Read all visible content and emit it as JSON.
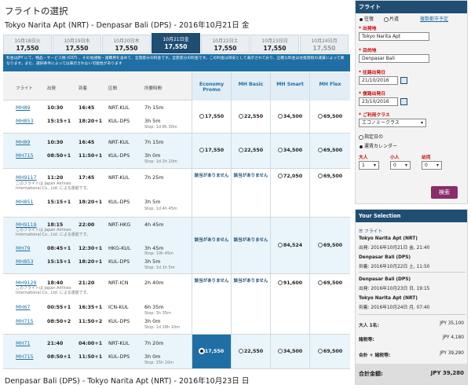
{
  "page": {
    "title": "フライトの選択",
    "outbound_route": "Tokyo Narita Apt (NRT) - Denpasar Bali (DPS) - 2016年10月21日 金",
    "return_route": "Denpasar Bali (DPS) - Tokyo Narita Apt (NRT) - 2016年10月23日 日"
  },
  "dates": [
    {
      "label": "10月18日火",
      "price": "17,550"
    },
    {
      "label": "10月19日水",
      "price": "17,550"
    },
    {
      "label": "10月20日木",
      "price": "17,550"
    },
    {
      "label": "10月21日金",
      "price": "17,550"
    },
    {
      "label": "10月22日土",
      "price": "17,550"
    },
    {
      "label": "10月23日日",
      "price": "17,550"
    },
    {
      "label": "10月24日月",
      "price": "17,550"
    }
  ],
  "notice": "料金はJPY にて、物品・サービス税 (GST) 、その他諸税・諸費用を含めて、全旅客分の料金です。全旅客分の料金です。この料金は目安として表示されており、正確な料金は往復旅程の運賃によって異なります。また、選択条件によっては表示されない可能性があります",
  "columns": {
    "flight": "フライト",
    "depart": "出発",
    "arrive": "到着",
    "route": "区間",
    "duration": "所要時間",
    "fare1": "Economy Promo",
    "fare2": "MH Basic",
    "fare3": "MH Smart",
    "fare4": "MH Flex"
  },
  "na_text": "該当がありません",
  "op_note": "このフライトは Japan Airlines International Co., Ltd. による運航です。",
  "rows": [
    {
      "f1": "MH89",
      "d1": "10:30",
      "a1": "16:45",
      "r1": "NRT-KUL",
      "t1": "7h 15m",
      "f2": "MH853",
      "d2": "15:15+1",
      "a2": "18:20+1",
      "r2": "KUL-DPS",
      "t2": "3h 5m",
      "s": "Stop: 1d 8h 30m",
      "p1": "17,550",
      "p2": "22,550",
      "p3": "34,500",
      "p4": "69,500"
    },
    {
      "f1": "MH89",
      "d1": "10:30",
      "a1": "16:45",
      "r1": "NRT-KUL",
      "t1": "7h 15m",
      "f2": "MH715",
      "d2": "08:50+1",
      "a2": "11:50+1",
      "r2": "KUL-DPS",
      "t2": "3h 0m",
      "s": "Stop: 1d 2h 20m",
      "p1": "17,550",
      "p2": "22,550",
      "p3": "34,500",
      "p4": "69,500"
    },
    {
      "f1": "MH9117",
      "d1": "11:20",
      "a1": "17:45",
      "r1": "NRT-KUL",
      "t1": "7h 25m",
      "f2": "MH851",
      "d2": "15:15+1",
      "a2": "18:20+1",
      "r2": "KUL-DPS",
      "t2": "3h 5m",
      "s": "Stop: 1d 4h 45m",
      "p3": "72,050",
      "p4": "69,500"
    },
    {
      "f1": "MH9119",
      "d1": "18:15",
      "a1": "22:00",
      "r1": "NRT-HKG",
      "t1": "4h 45m",
      "f2": "MH79",
      "d2": "08:45+1",
      "a2": "12:30+1",
      "r2": "HKG-KUL",
      "t2": "3h 45m",
      "s1": "Stop: 10h 45m",
      "f3": "MH853",
      "d3": "15:15+1",
      "a3": "18:20+1",
      "r3": "KUL-DPS",
      "t3": "3h 5m",
      "s2": "Stop: 1d 1h 5m",
      "p3": "84,524",
      "p4": "69,500"
    },
    {
      "f1": "MH9129",
      "d1": "18:40",
      "a1": "21:20",
      "r1": "NRT-ICN",
      "t1": "2h 40m",
      "f2": "MH67",
      "d2": "00:55+1",
      "a2": "16:35+1",
      "r2": "ICN-KUL",
      "t2": "6h 35m",
      "s1": "Stop: 3h 35m",
      "f3": "MH715",
      "d3": "08:50+2",
      "a3": "11:50+2",
      "r3": "KUL-DPS",
      "t3": "3h 0m",
      "s2": "Stop: 1d 18h 10m",
      "p3": "91,600",
      "p4": "69,500"
    },
    {
      "f1": "MH71",
      "d1": "21:40",
      "a1": "04:00+1",
      "r1": "NRT-KUL",
      "t1": "7h 20m",
      "f2": "MH715",
      "d2": "08:50+1",
      "a2": "11:50+1",
      "r2": "KUL-DPS",
      "t2": "3h 0m",
      "s": "Stop: 15h 10m",
      "p1": "17,550",
      "p2": "22,550",
      "p3": "34,500",
      "p4": "69,500"
    }
  ],
  "sidebar": {
    "title": "フライト",
    "trip_roundtrip": "往復",
    "trip_oneway": "片道",
    "multi_city": "複数都市予定",
    "from_label": "* 出発地",
    "from_value": "Tokyo Narita Apt",
    "to_label": "* 目的地",
    "to_value": "Denpasar Bali",
    "depart_label": "* 往路出発日",
    "depart_value": "21/10/2016",
    "return_label": "* 復路出発日",
    "return_value": "23/10/2016",
    "class_label": "* ご利用クラス",
    "class_value": "エコノミークラス",
    "opt_fixed": "指定日の",
    "opt_calendar": "運賃カレンダー",
    "adult_label": "大人",
    "child_label": "小人",
    "infant_label": "幼児",
    "adult_value": "1",
    "child_value": "0",
    "infant_value": "0",
    "search_button": "検索"
  },
  "selection": {
    "title": "Your Selection",
    "flight_label": "フライト",
    "seg1_route": "Tokyo Narita Apt (NRT)",
    "seg1_time": "出発: 2016年10月21日 金, 21:40",
    "seg2_route": "Denpasar Bali (DPS)",
    "seg2_time": "到着: 2016年10月22日 土, 11:50",
    "seg3_route": "Denpasar Bali (DPS)",
    "seg3_time": "出発: 2016年10月23日 日, 19:15",
    "seg4_route": "Tokyo Narita Apt (NRT)",
    "seg4_time": "到着: 2016年10月24日 月, 07:40",
    "adult_label": "大人 1名:",
    "adult_value": "JPY 35,100",
    "tax_label": "諸税等:",
    "tax_value": "JPY 4,180",
    "total_fee_label": "合計 + 諸税等:",
    "total_fee_value": "JPY 39,280",
    "grand_label": "合計金額:",
    "grand_value": "JPY 39,280"
  }
}
